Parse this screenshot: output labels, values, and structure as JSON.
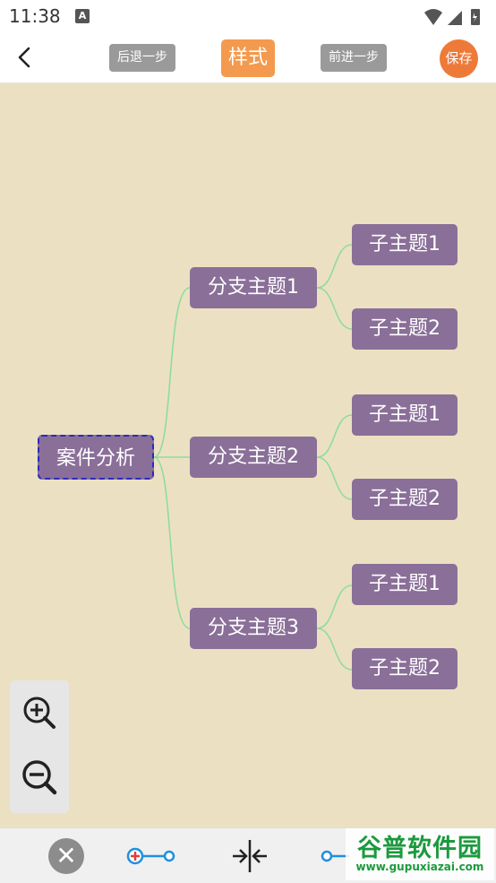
{
  "status": {
    "time": "11:38",
    "notif_icon": "A"
  },
  "toolbar": {
    "undo_label": "后退一步",
    "style_label": "样式",
    "redo_label": "前进一步",
    "save_label": "保存"
  },
  "mindmap": {
    "root": "案件分析",
    "branches": [
      {
        "label": "分支主题1",
        "subs": [
          "子主题1",
          "子主题2"
        ]
      },
      {
        "label": "分支主题2",
        "subs": [
          "子主题1",
          "子主题2"
        ]
      },
      {
        "label": "分支主题3",
        "subs": [
          "子主题1",
          "子主题2"
        ]
      }
    ]
  },
  "colors": {
    "canvas_bg": "#ebe1c2",
    "node_fill": "#8a6f98",
    "connector": "#8fdc9c",
    "style_button": "#f39a4e",
    "save_button": "#ee7a3a",
    "root_border": "#2a2ac0"
  },
  "watermark": {
    "title": "谷普软件园",
    "url": "www.gupuxiazai.com"
  }
}
